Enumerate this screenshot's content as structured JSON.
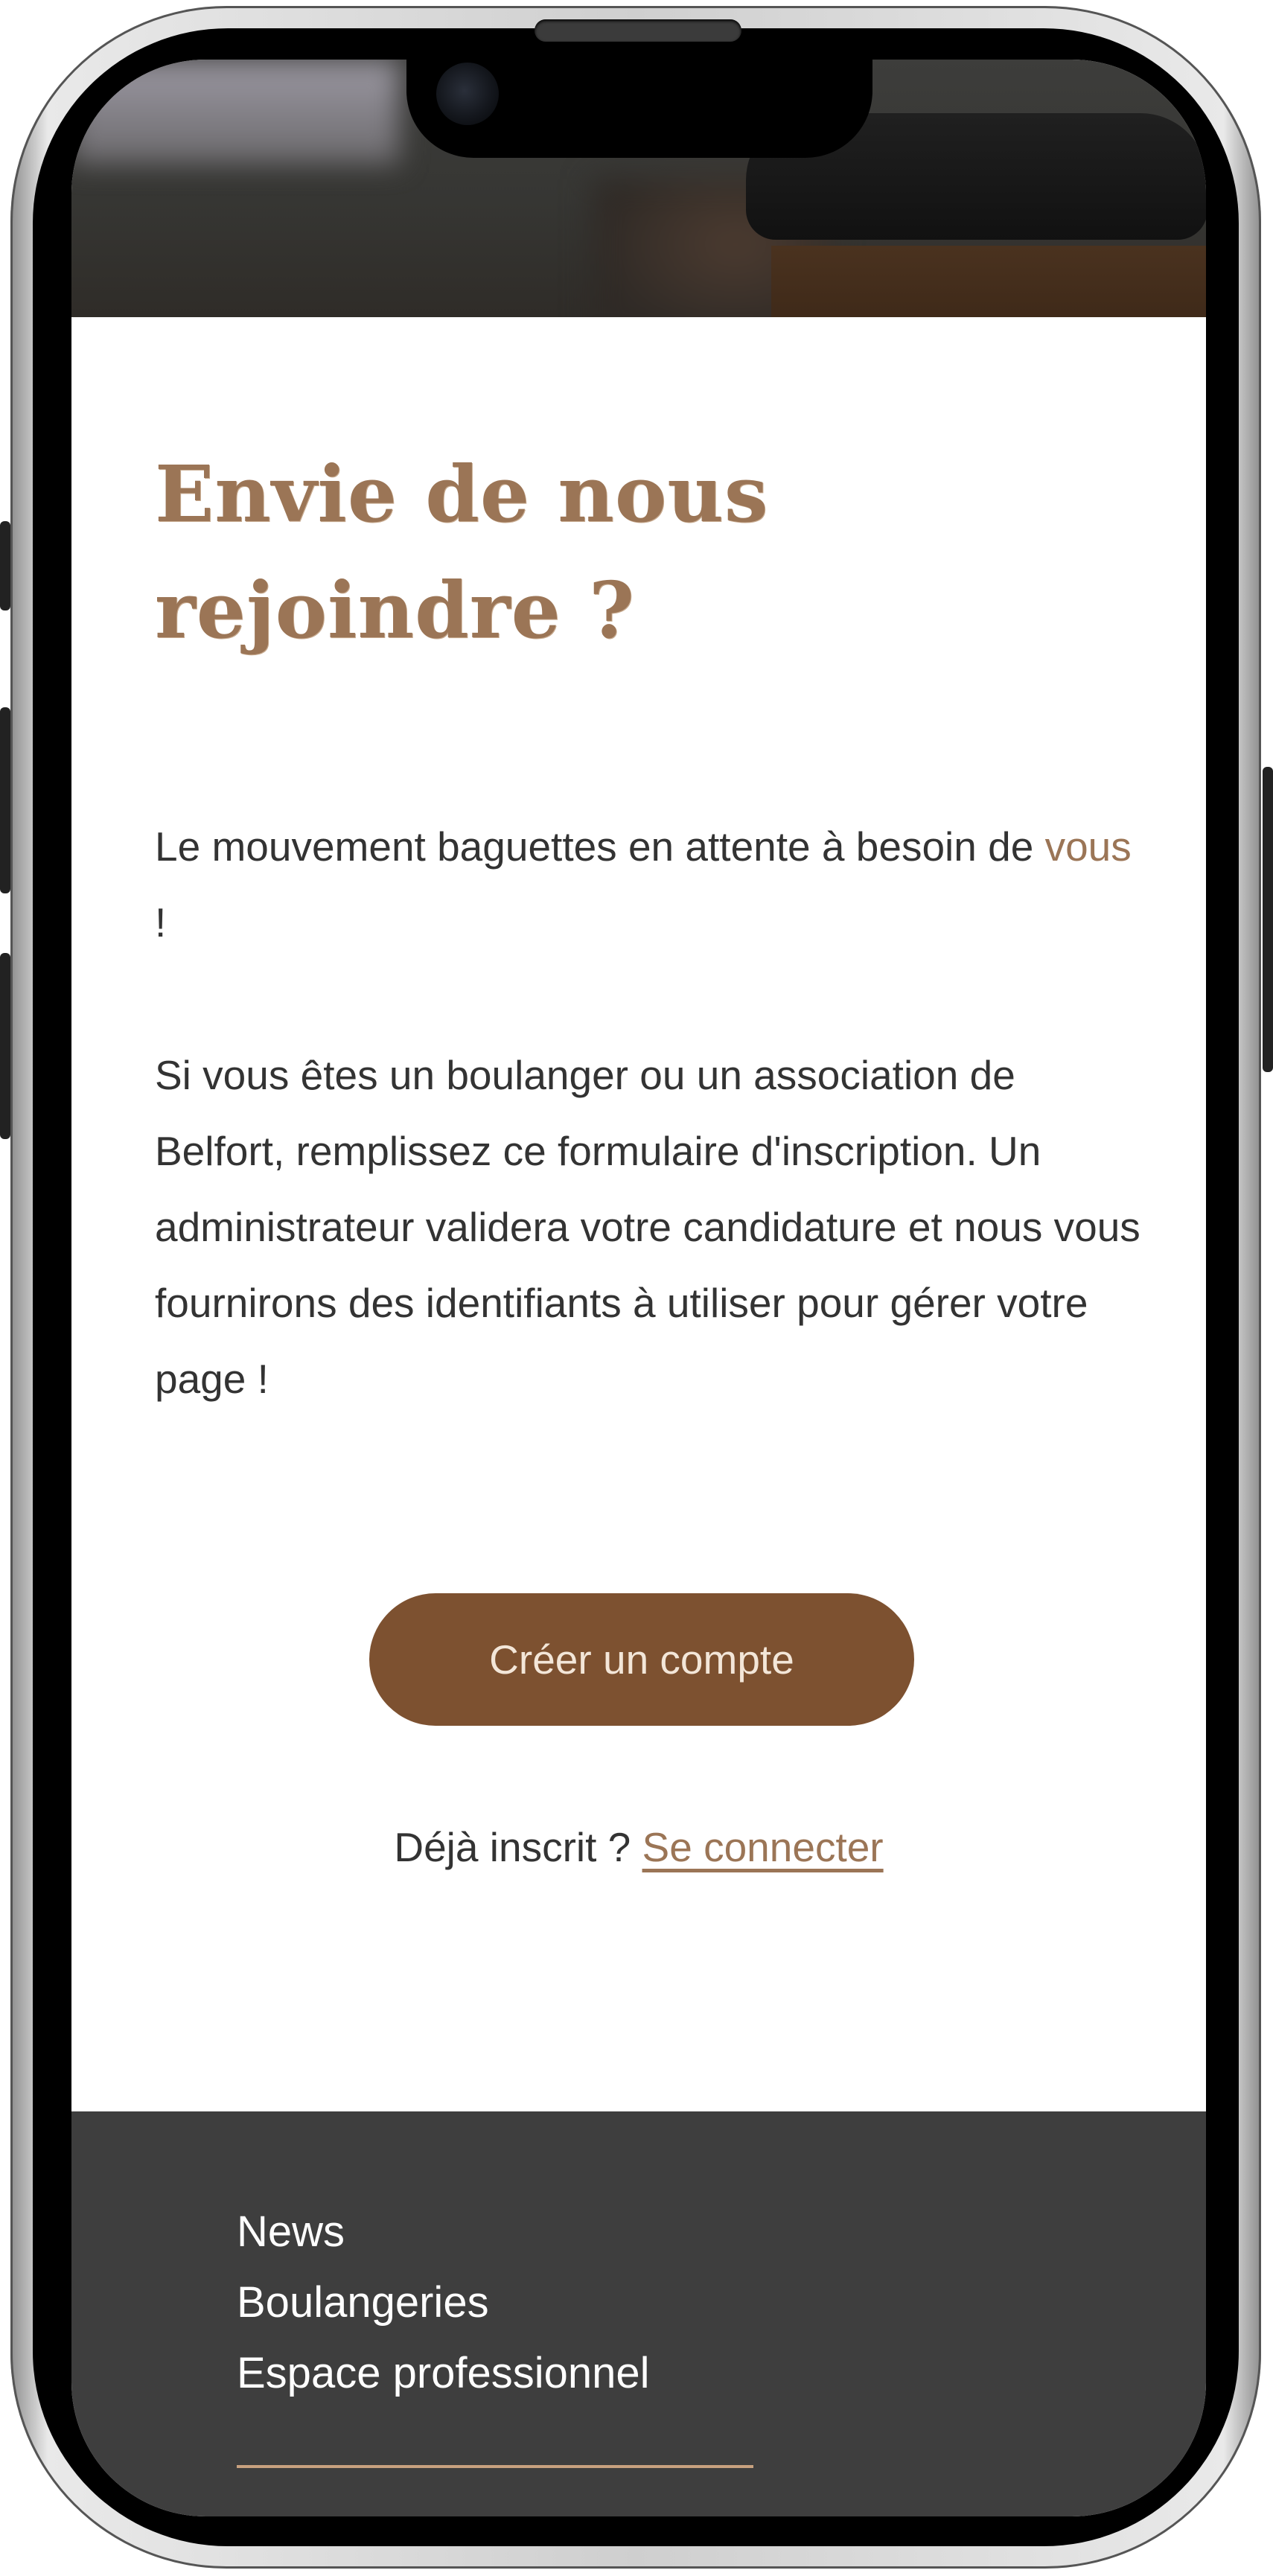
{
  "page": {
    "title_line1": "Envie de nous",
    "title_line2": "rejoindre ?",
    "intro_before": "Le mouvement baguettes en attente à besoin de ",
    "intro_accent": "vous",
    "intro_after": " !",
    "body_text": "Si vous êtes un boulanger ou un association de Belfort, remplissez ce formulaire d'inscription. Un administrateur validera votre candidature et nous vous fournirons des identifiants à utiliser pour gérer votre page !",
    "create_account_label": "Créer un compte",
    "already_registered": "Déjà inscrit ? ",
    "login_link": "Se connecter"
  },
  "footer": {
    "links": [
      "News",
      "Boulangeries",
      "Espace professionnel"
    ]
  },
  "colors": {
    "accent": "#9b7556",
    "button": "#7d5130",
    "footer_bg": "#3e3e3e",
    "footer_rule": "#c7a17f"
  }
}
